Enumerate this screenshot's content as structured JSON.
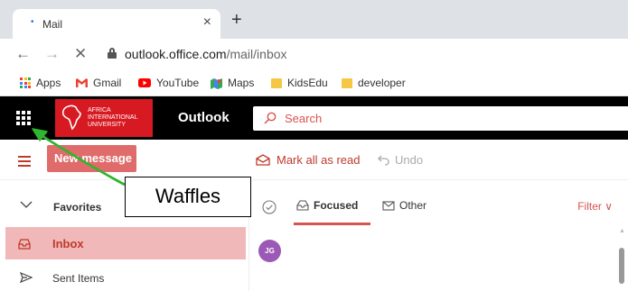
{
  "browser": {
    "tab_title": "Mail",
    "tab_close": "×",
    "new_tab": "+",
    "back": "←",
    "forward": "→",
    "stop": "✕",
    "url_host": "outlook.office.com",
    "url_path": "/mail/inbox",
    "bookmarks": [
      {
        "label": "Apps",
        "icon": "apps-grid-icon"
      },
      {
        "label": "Gmail",
        "icon": "gmail-icon"
      },
      {
        "label": "YouTube",
        "icon": "youtube-icon"
      },
      {
        "label": "Maps",
        "icon": "maps-icon"
      },
      {
        "label": "KidsEdu",
        "icon": "folder-icon"
      },
      {
        "label": "developer",
        "icon": "folder-icon"
      }
    ]
  },
  "header": {
    "logo_lines": [
      "AFRICA",
      "INTERNATIONAL",
      "UNIVERSITY"
    ],
    "app_name": "Outlook",
    "search_placeholder": "Search"
  },
  "commands": {
    "new_message": "New message",
    "mark_all_read": "Mark all as read",
    "undo": "Undo"
  },
  "folders": {
    "favorites": "Favorites",
    "inbox": "Inbox",
    "sent_items": "Sent Items"
  },
  "message_list": {
    "tab_focused": "Focused",
    "tab_other": "Other",
    "filter": "Filter ∨",
    "avatar_initials": "JG"
  },
  "annotation": {
    "label": "Waffles",
    "color": "#2fb52f"
  },
  "colors": {
    "brand_red": "#d71921",
    "accent": "#c0392b",
    "selected_folder": "#f0b8b8"
  }
}
